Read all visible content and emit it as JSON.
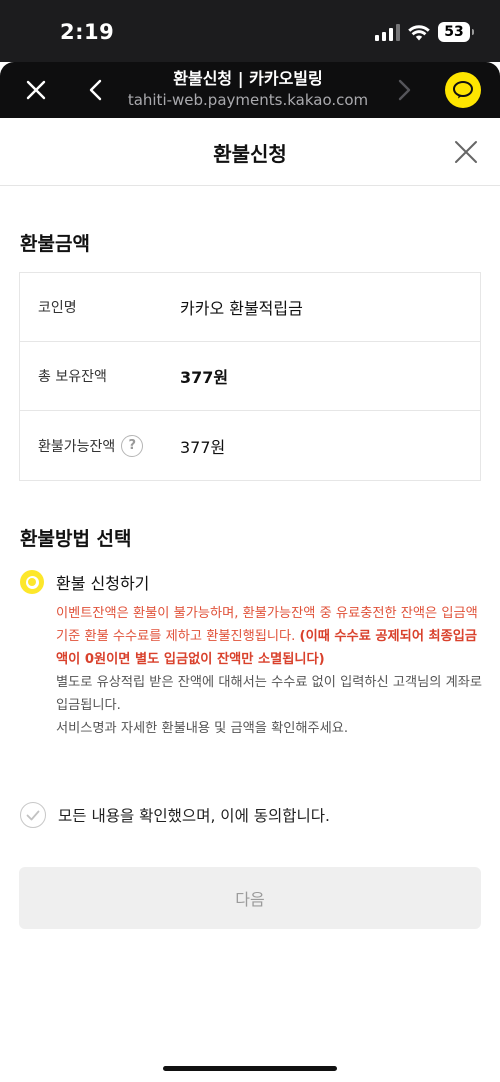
{
  "status_bar": {
    "time": "2:19",
    "battery": "53"
  },
  "browser": {
    "title": "환불신청 | 카카오빌링",
    "url": "tahiti-web.payments.kakao.com"
  },
  "header": {
    "title": "환불신청"
  },
  "refund_amount": {
    "section_title": "환불금액",
    "rows": [
      {
        "label": "코인명",
        "value": "카카오 환불적립금"
      },
      {
        "label": "총 보유잔액",
        "value": "377원"
      },
      {
        "label": "환불가능잔액",
        "value": "377원",
        "help": "?"
      }
    ]
  },
  "refund_method": {
    "section_title": "환불방법 선택",
    "option_label": "환불 신청하기",
    "notice": {
      "red_text": "이벤트잔액은 환불이 불가능하며, 환불가능잔액 중 유료충전한 잔액은 입금액 기준 환불 수수료를 제하고 환불진행됩니다. ",
      "red_bold_text": "(이때 수수료 공제되어 최종입금액이 0원이면 별도 입금없이 잔액만 소멸됩니다)",
      "line2": "별도로 유상적립 받은 잔액에 대해서는 수수료 없이 입력하신 고객님의 계좌로 입금됩니다.",
      "line3": "서비스명과 자세한 환불내용 및 금액을 확인해주세요."
    }
  },
  "agreement": {
    "label": "모든 내용을 확인했으며, 이에 동의합니다."
  },
  "next_button": {
    "label": "다음"
  },
  "colors": {
    "accent_yellow": "#fee500",
    "notice_red": "#e0523a",
    "disabled_button": "#efefef"
  }
}
